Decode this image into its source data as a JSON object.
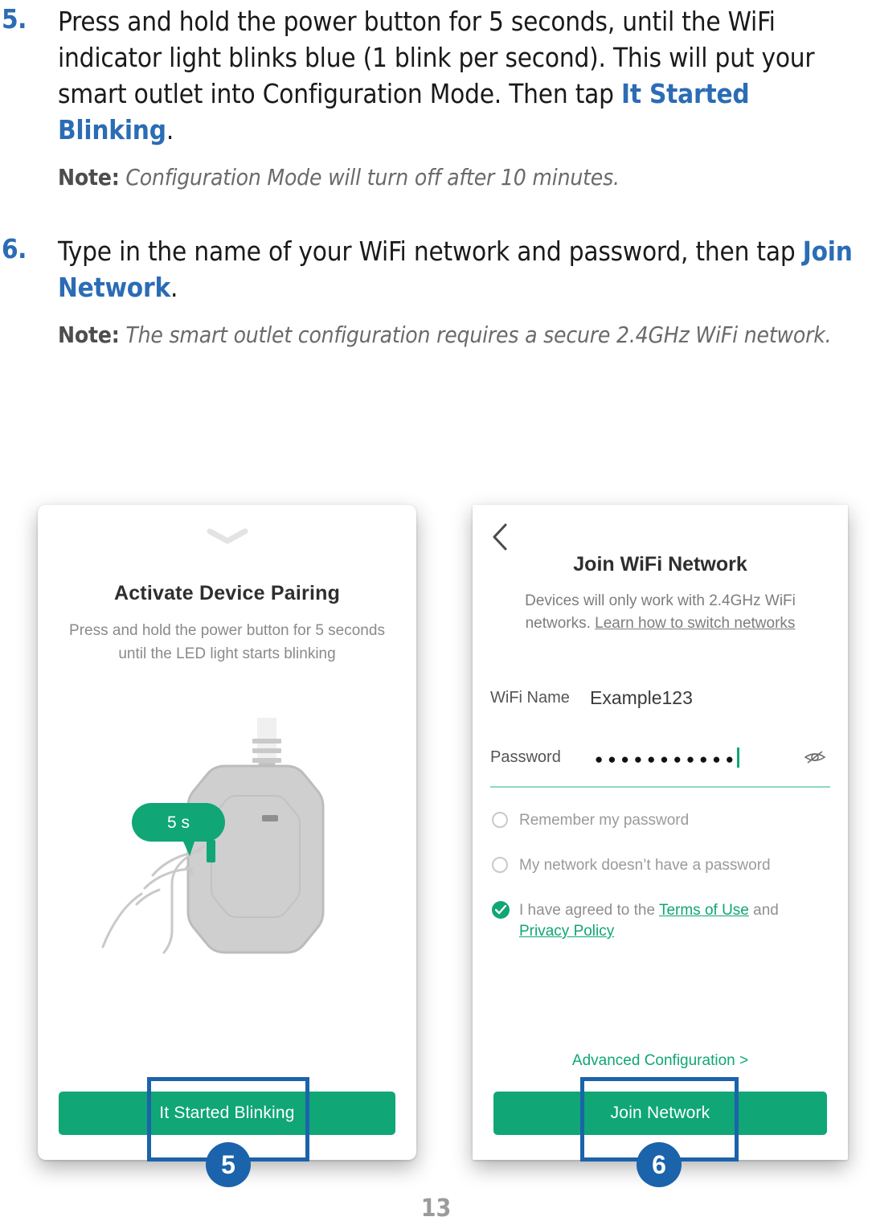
{
  "steps": [
    {
      "number": "5.",
      "text_before": "Press and hold the power button for 5 seconds, until the WiFi indicator light blinks blue (1 blink per second). This will put your smart outlet into Configuration Mode. Then tap ",
      "highlight": "It Started Blinking",
      "text_after": ".",
      "note_label": "Note:",
      "note_text": " Configuration Mode will turn off after 10 minutes."
    },
    {
      "number": "6.",
      "text_before": "Type in the name of your WiFi network and password, then tap ",
      "highlight": "Join Network",
      "text_after": ".",
      "note_label": "Note:",
      "note_text": " The smart outlet configuration requires a secure 2.4GHz WiFi network."
    }
  ],
  "left_screen": {
    "chevron_icon": "chevron-down-icon",
    "title": "Activate Device Pairing",
    "subtitle": "Press and hold the power button for 5 seconds until the LED light starts blinking",
    "timer_bubble": "5 s",
    "cta_label": "It Started Blinking"
  },
  "right_screen": {
    "back_icon": "chevron-left-icon",
    "title": "Join WiFi Network",
    "subtitle_text": "Devices will only work with 2.4GHz WiFi networks. ",
    "subtitle_link": "Learn how to switch networks",
    "wifi_label": "WiFi Name",
    "wifi_value": "Example123",
    "password_label": "Password",
    "password_masked": "●●●●●●●●●●●",
    "eye_icon": "eye-off-icon",
    "options": [
      {
        "label": "Remember my password",
        "state": "unchecked"
      },
      {
        "label": "My network doesn’t have a password",
        "state": "unchecked"
      }
    ],
    "agreement": {
      "state": "checked",
      "prefix": "I have agreed to the ",
      "link1": "Terms of Use",
      "middle": " and ",
      "link2": "Privacy Policy"
    },
    "advanced_link": "Advanced Configuration >",
    "cta_label": "Join Network"
  },
  "annotations": {
    "badge_left": "5",
    "badge_right": "6"
  },
  "page_number": "13",
  "colors": {
    "accent_blue": "#2b6cb5",
    "annotation_blue": "#1b63ab",
    "brand_green": "#10a675",
    "body_text": "#1a1a1a",
    "note_text": "#6a6a6a"
  }
}
